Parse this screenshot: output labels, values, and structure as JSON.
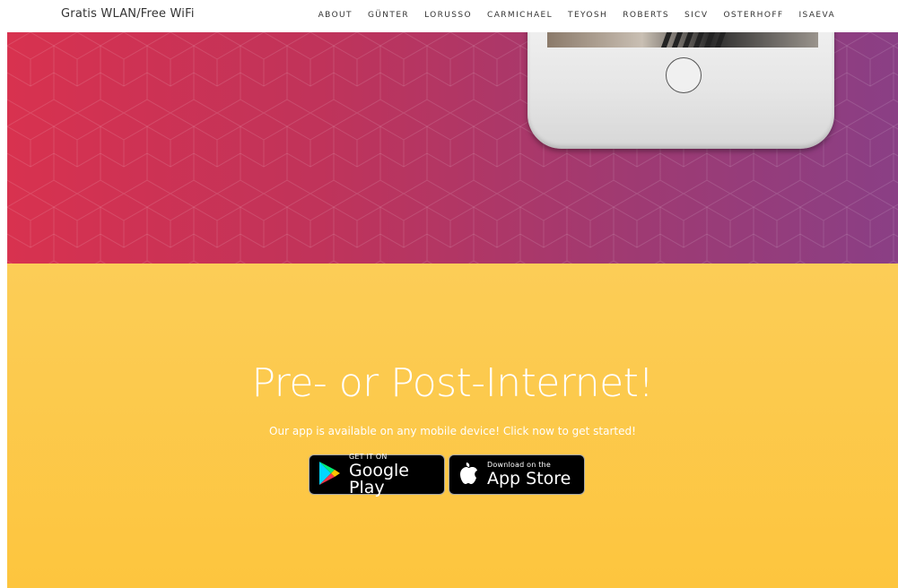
{
  "nav": {
    "brand": "Gratis WLAN/Free WiFi",
    "links": [
      {
        "label": "ABOUT"
      },
      {
        "label": "GÜNTER"
      },
      {
        "label": "LORUSSO"
      },
      {
        "label": "CARMICHAEL"
      },
      {
        "label": "TEYOSH"
      },
      {
        "label": "ROBERTS"
      },
      {
        "label": "SICV"
      },
      {
        "label": "OSTERHOFF"
      },
      {
        "label": "ISAEVA"
      }
    ]
  },
  "hero": {
    "colors": {
      "left": "#d8324f",
      "right": "#8a3f85"
    }
  },
  "cta": {
    "title": "Pre- or Post-Internet!",
    "subtitle": "Our app is available on any mobile device! Click now to get started!",
    "google_badge": {
      "small": "GET IT ON",
      "big": "Google Play",
      "icon": "google-play-icon"
    },
    "apple_badge": {
      "small": "Download on the",
      "big": "App Store",
      "icon": "apple-icon"
    },
    "color": "#fdc53e"
  }
}
